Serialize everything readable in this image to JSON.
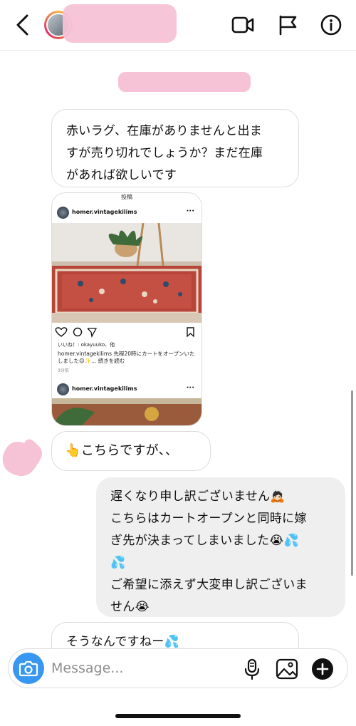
{
  "header": {
    "contact_name": "",
    "icons": [
      "back-chevron-icon",
      "video-call-icon",
      "report-flag-icon",
      "info-icon"
    ]
  },
  "messages": {
    "m1": {
      "line1": "赤いラグ、在庫がありませんと出ま",
      "line2": "すが売り切れでしょうか？まだ在庫",
      "line3": "があれば欲しいです"
    },
    "shared_post": {
      "top_label": "投稿",
      "username": "homer.vintagekilims",
      "more": "···",
      "likes": "いいね！: okayuuko、他",
      "caption_line1": "homer.vintagekilims 先程20時にカートをオープンいた",
      "caption_line2": "しました😊✨... 続きを読む",
      "time": "3分前",
      "username2": "homer.vintagekilims",
      "more2": "···"
    },
    "m2": {
      "text": "👆こちらですが、、"
    },
    "m3": {
      "line1": "遅くなり申し訳ございません🙇🏻",
      "line2": "こちらはカートオープンと同時に嫁",
      "line3": "ぎ先が決まってしまいました😭💦",
      "line4": "💦",
      "line5": "ご希望に添えず大変申し訳ございま",
      "line6": "せん😭"
    },
    "m4": {
      "text": "そうなんですねー💦"
    }
  },
  "input": {
    "placeholder": "Message...",
    "icons": [
      "camera-icon",
      "microphone-icon",
      "gallery-icon",
      "add-icon"
    ]
  },
  "colors": {
    "accent": "#3897f0",
    "incoming_bubble": "#ffffff",
    "outgoing_bubble": "#efefef",
    "privacy_mask": "#f6c2d6"
  }
}
